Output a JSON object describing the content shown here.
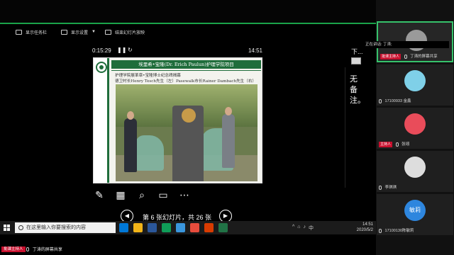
{
  "presenter_toolbar": {
    "show_taskbar": "显示任务栏",
    "display_settings": "显示设置",
    "end_show": "结束幻灯片放映"
  },
  "timer": {
    "elapsed": "0:15:29",
    "clock": "14:51"
  },
  "slide": {
    "title": "埃里希•宝隆(Dr. Erich Paulun)护理学院项目",
    "caption_lines": [
      "护理学院展革章•宝隆博士纪念碑揭幕",
      "德卫村长Henry Tesch先生（左）Pasewalk市长Rainer Dambach先生（右）"
    ]
  },
  "navigation": {
    "slide_status": "第 6 张幻灯片，共 26 张",
    "prev_icon": "chevron-left-icon",
    "next_icon": "chevron-right-icon"
  },
  "next_panel": {
    "label": "下...",
    "notes": "无备注。"
  },
  "taskbar": {
    "search_placeholder": "在这里输入你要搜索的内容",
    "time": "14:51",
    "date": "2020/5/2",
    "apps": [
      "#0078d7",
      "#f2b418",
      "#2b579a",
      "#0f9d58",
      "#e74c3c",
      "#217346",
      "#d83b01",
      "#3a96dd"
    ]
  },
  "share_bar": {
    "host_label": "批课主持人",
    "text": "丁涛的屏幕共享"
  },
  "participants": {
    "speaking": "正在讲话: 丁涛;",
    "tiles": [
      {
        "host": "批课主持人",
        "name": "丁涛的屏幕共享",
        "avatar_color": "#9a9a9a",
        "active": true
      },
      {
        "host": "",
        "name": "17100933 金鑫",
        "avatar_color": "#7fd0e8",
        "active": false
      },
      {
        "host": "主持人",
        "name": "张翊",
        "avatar_color": "#e94c5a",
        "active": false
      },
      {
        "host": "",
        "name": "李琪琪",
        "avatar_color": "#dddddd",
        "active": false
      },
      {
        "host": "",
        "name": "17100130陈敏莉",
        "avatar_color": "#2e86de",
        "avatar_text": "敏莉",
        "active": false
      }
    ]
  }
}
